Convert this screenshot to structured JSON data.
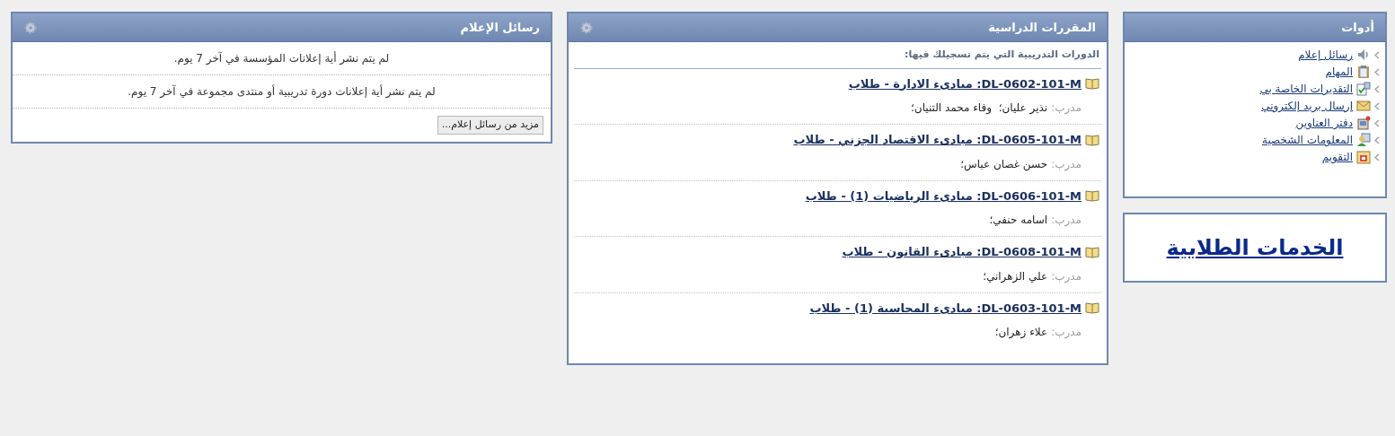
{
  "tools": {
    "title": "أدوات",
    "items": [
      {
        "label": "رسائل إعلام"
      },
      {
        "label": "المهام"
      },
      {
        "label": "التقديرات الخاصة بي"
      },
      {
        "label": "إرسال بريد إلكتروني"
      },
      {
        "label": "دفتر العناوين"
      },
      {
        "label": "المعلومات الشخصية"
      },
      {
        "label": "التقويم"
      }
    ]
  },
  "student_services": {
    "label": "الخدمات الطلابية"
  },
  "courses": {
    "title": "المقررات الدراسية",
    "subtitle": "الدورات التدريبية التي يتم تسجيلك فيها:",
    "items": [
      {
        "title": "DL-0602-101-M: مبادىء الادارة - طلاب",
        "instructor_label": "مدرب:",
        "instructors": "نذير عليان؛  وفاء محمد التنيان؛"
      },
      {
        "title": "DL-0605-101-M: مبادىء الاقتصاد الجزني - طلاب",
        "instructor_label": "مدرب:",
        "instructors": "حسن غصان عباس؛"
      },
      {
        "title": "DL-0606-101-M: مبادىء الرياضيات (1) - طلاب",
        "instructor_label": "مدرب:",
        "instructors": "اسامه حنفي؛"
      },
      {
        "title": "DL-0608-101-M: مبادىء القانون - طلاب",
        "instructor_label": "مدرب:",
        "instructors": "علي الزهراني؛"
      },
      {
        "title": "DL-0603-101-M: مبادىء المحاسبة (1) - طلاب",
        "instructor_label": "مدرب:",
        "instructors": "علاء زهران؛"
      }
    ]
  },
  "announcements": {
    "title": "رسائل الإعلام",
    "messages": [
      "لم يتم نشر أية إعلانات المؤسسة في آخر 7 يوم.",
      "لم يتم نشر أية إعلانات دورة تدريبية أو منتدى مجموعة في آخر 7 يوم."
    ],
    "more_button": "مزيد من رسائل إعلام..."
  }
}
